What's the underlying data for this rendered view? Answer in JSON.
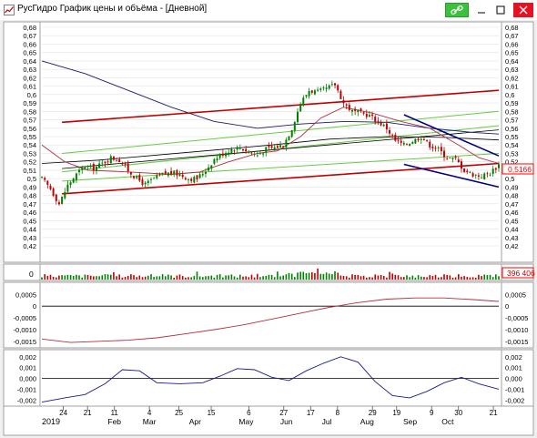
{
  "window": {
    "title": "РусГидро График цены и объёма - [Дневной]"
  },
  "price_axis": {
    "ticks": [
      "0,68",
      "0,67",
      "0,66",
      "0,65",
      "0,64",
      "0,63",
      "0,62",
      "0,61",
      "0,6",
      "0,59",
      "0,58",
      "0,57",
      "0,56",
      "0,55",
      "0,54",
      "0,53",
      "0,52",
      "0,51",
      "0,5",
      "0,49",
      "0,48",
      "0,47",
      "0,46",
      "0,45",
      "0,44",
      "0,43",
      "0,42"
    ],
    "current_value": "0,5166"
  },
  "volume_panel": {
    "left_label": "0",
    "value_label": "396 406"
  },
  "macd_panel": {
    "ticks": [
      "0,0005",
      "0",
      "-0,0005",
      "-0,0010",
      "-0,0015"
    ]
  },
  "osc_panel": {
    "ticks": [
      "0,002",
      "0,001",
      "0,000",
      "-0,001",
      "-0,002"
    ]
  },
  "x_axis": {
    "day_ticks": [
      "24",
      "21",
      "11",
      "4",
      "25",
      "15",
      "6",
      "27",
      "17",
      "8",
      "29",
      "19",
      "9",
      "30",
      "21"
    ],
    "year_label": "2019",
    "months": [
      "Feb",
      "Mar",
      "Apr",
      "May",
      "Jun",
      "Jul",
      "Aug",
      "Sep",
      "Oct"
    ]
  },
  "colors": {
    "up_candle": "#008000",
    "down_candle": "#c00000",
    "ma_long": "#1a1a6e",
    "ma_mid": "#000000",
    "ma_short": "#b03040",
    "channel_red": "#c00000",
    "channel_green": "#66cc44",
    "channel_navy": "#000080",
    "price_marker": "#ff0000"
  },
  "chart_data": {
    "type": "candlestick",
    "x_range": [
      "2019-01-09",
      "2019-10-22"
    ],
    "price_ylim": [
      0.42,
      0.68
    ],
    "close_path": [
      [
        0,
        0.5
      ],
      [
        3,
        0.488
      ],
      [
        6,
        0.47
      ],
      [
        9,
        0.492
      ],
      [
        12,
        0.505
      ],
      [
        15,
        0.515
      ],
      [
        18,
        0.512
      ],
      [
        21,
        0.518
      ],
      [
        24,
        0.525
      ],
      [
        27,
        0.522
      ],
      [
        30,
        0.51
      ],
      [
        33,
        0.5
      ],
      [
        36,
        0.493
      ],
      [
        39,
        0.5
      ],
      [
        42,
        0.505
      ],
      [
        45,
        0.507
      ],
      [
        48,
        0.505
      ],
      [
        51,
        0.5
      ],
      [
        54,
        0.5
      ],
      [
        57,
        0.51
      ],
      [
        60,
        0.523
      ],
      [
        63,
        0.53
      ],
      [
        66,
        0.535
      ],
      [
        69,
        0.537
      ],
      [
        72,
        0.532
      ],
      [
        75,
        0.528
      ],
      [
        78,
        0.535
      ],
      [
        81,
        0.537
      ],
      [
        84,
        0.54
      ],
      [
        87,
        0.56
      ],
      [
        90,
        0.59
      ],
      [
        93,
        0.605
      ],
      [
        96,
        0.603
      ],
      [
        99,
        0.607
      ],
      [
        102,
        0.612
      ],
      [
        105,
        0.59
      ],
      [
        108,
        0.58
      ],
      [
        111,
        0.578
      ],
      [
        114,
        0.575
      ],
      [
        117,
        0.568
      ],
      [
        120,
        0.56
      ],
      [
        123,
        0.545
      ],
      [
        126,
        0.54
      ],
      [
        129,
        0.545
      ],
      [
        132,
        0.55
      ],
      [
        135,
        0.54
      ],
      [
        138,
        0.535
      ],
      [
        141,
        0.525
      ],
      [
        144,
        0.523
      ],
      [
        147,
        0.51
      ],
      [
        150,
        0.505
      ],
      [
        153,
        0.503
      ],
      [
        156,
        0.507
      ],
      [
        159,
        0.5166
      ]
    ],
    "moving_averages": {
      "long": [
        [
          0,
          0.64
        ],
        [
          15,
          0.625
        ],
        [
          30,
          0.605
        ],
        [
          45,
          0.585
        ],
        [
          60,
          0.568
        ],
        [
          75,
          0.56
        ],
        [
          90,
          0.565
        ],
        [
          105,
          0.568
        ],
        [
          120,
          0.567
        ],
        [
          135,
          0.56
        ],
        [
          150,
          0.555
        ],
        [
          159,
          0.553
        ]
      ],
      "mid": [
        [
          0,
          0.518
        ],
        [
          20,
          0.522
        ],
        [
          40,
          0.528
        ],
        [
          60,
          0.534
        ],
        [
          80,
          0.54
        ],
        [
          100,
          0.547
        ],
        [
          120,
          0.55
        ],
        [
          140,
          0.549
        ],
        [
          159,
          0.546
        ]
      ],
      "short": [
        [
          0,
          0.54
        ],
        [
          8,
          0.52
        ],
        [
          16,
          0.51
        ],
        [
          30,
          0.508
        ],
        [
          45,
          0.505
        ],
        [
          55,
          0.508
        ],
        [
          65,
          0.52
        ],
        [
          75,
          0.53
        ],
        [
          82,
          0.533
        ],
        [
          90,
          0.55
        ],
        [
          97,
          0.572
        ],
        [
          105,
          0.585
        ],
        [
          115,
          0.578
        ],
        [
          125,
          0.568
        ],
        [
          135,
          0.56
        ],
        [
          145,
          0.54
        ],
        [
          152,
          0.525
        ],
        [
          159,
          0.518
        ]
      ]
    },
    "channels": {
      "red": [
        [
          [
            7,
            0.567
          ],
          [
            159,
            0.605
          ]
        ],
        [
          [
            7,
            0.482
          ],
          [
            159,
            0.518
          ]
        ]
      ],
      "green": [
        [
          [
            7,
            0.53
          ],
          [
            159,
            0.58
          ]
        ],
        [
          [
            7,
            0.497
          ],
          [
            159,
            0.53
          ]
        ],
        [
          [
            7,
            0.508
          ],
          [
            159,
            0.563
          ]
        ]
      ],
      "navy": [
        [
          [
            126,
            0.576
          ],
          [
            159,
            0.527
          ]
        ],
        [
          [
            126,
            0.517
          ],
          [
            159,
            0.49
          ]
        ]
      ],
      "black": [
        [
          [
            7,
            0.512
          ],
          [
            159,
            0.558
          ]
        ]
      ]
    },
    "macd_ylim": [
      -0.0017,
      0.0009
    ],
    "macd": [
      [
        0,
        -0.0014
      ],
      [
        10,
        -0.00155
      ],
      [
        20,
        -0.0015
      ],
      [
        30,
        -0.00145
      ],
      [
        40,
        -0.00135
      ],
      [
        50,
        -0.00118
      ],
      [
        60,
        -0.001
      ],
      [
        70,
        -0.0008
      ],
      [
        80,
        -0.00055
      ],
      [
        90,
        -0.0003
      ],
      [
        100,
        -5e-05
      ],
      [
        110,
        0.00015
      ],
      [
        120,
        0.0003
      ],
      [
        130,
        0.00035
      ],
      [
        140,
        0.00035
      ],
      [
        150,
        0.00028
      ],
      [
        159,
        0.0002
      ]
    ],
    "osc_ylim": [
      -0.0024,
      0.0024
    ],
    "osc": [
      [
        0,
        -0.0022
      ],
      [
        8,
        -0.0018
      ],
      [
        15,
        -0.0015
      ],
      [
        22,
        -0.0005
      ],
      [
        28,
        0.0008
      ],
      [
        34,
        0.0007
      ],
      [
        40,
        -0.0004
      ],
      [
        48,
        -0.0005
      ],
      [
        56,
        -0.0004
      ],
      [
        62,
        0.0002
      ],
      [
        68,
        0.0009
      ],
      [
        74,
        0.0008
      ],
      [
        80,
        0.0001
      ],
      [
        86,
        -0.0002
      ],
      [
        92,
        0.0007
      ],
      [
        98,
        0.0014
      ],
      [
        104,
        0.002
      ],
      [
        110,
        0.0015
      ],
      [
        116,
        -0.0003
      ],
      [
        122,
        -0.0016
      ],
      [
        128,
        -0.0018
      ],
      [
        134,
        -0.0012
      ],
      [
        140,
        -0.0004
      ],
      [
        146,
        0.0001
      ],
      [
        152,
        -0.0005
      ],
      [
        159,
        -0.001
      ]
    ]
  }
}
